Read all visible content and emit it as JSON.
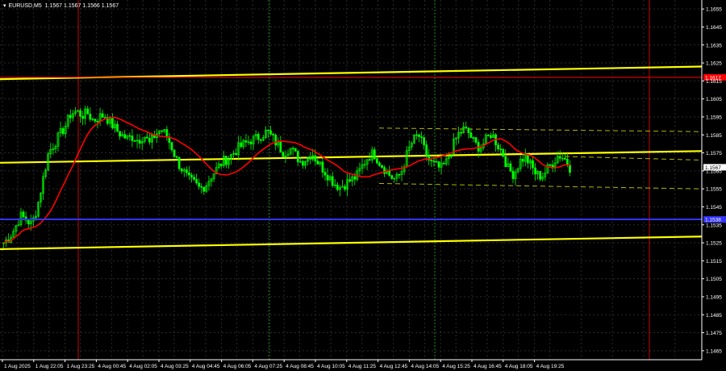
{
  "header": {
    "symbol_label": "EURUSD,M5",
    "ohlc": "1.1567 1.1567 1.1566 1.1567"
  },
  "colors": {
    "background": "#000000",
    "grid": "#2b2b2b",
    "candle": "#00ff00",
    "ma": "#ff0000",
    "channel": "#ffff00",
    "channel_dashed": "#b5b500",
    "level_red": "#ff0000",
    "level_blue": "#3333ff",
    "session_line": "#cc0000",
    "vline_green": "#228b22",
    "axis_text": "#ffffff"
  },
  "chart_data": {
    "type": "candlestick",
    "y_axis": {
      "min": 1.146,
      "max": 1.166,
      "ticks": [
        "1.1655",
        "1.1645",
        "1.1635",
        "1.1625",
        "1.1615",
        "1.1605",
        "1.1595",
        "1.1585",
        "1.1575",
        "1.1565",
        "1.1555",
        "1.1545",
        "1.1535",
        "1.1525",
        "1.1515",
        "1.1505",
        "1.1495",
        "1.1485",
        "1.1475",
        "1.1465"
      ]
    },
    "x_axis": {
      "ticks": [
        "1 Aug 2025",
        "1 Aug 22:05",
        "1 Aug 23:25",
        "4 Aug 00:45",
        "4 Aug 02:05",
        "4 Aug 03:25",
        "4 Aug 04:45",
        "4 Aug 06:05",
        "4 Aug 07:25",
        "4 Aug 08:45",
        "4 Aug 10:05",
        "4 Aug 11:25",
        "4 Aug 12:45",
        "4 Aug 14:05",
        "4 Aug 15:25",
        "4 Aug 16:45",
        "4 Aug 18:05",
        "4 Aug 19:25"
      ]
    },
    "price_path": [
      1.1525,
      1.1528,
      1.1533,
      1.154,
      1.1538,
      1.1535,
      1.1545,
      1.156,
      1.1575,
      1.158,
      1.1585,
      1.159,
      1.1597,
      1.1598,
      1.1596,
      1.1597,
      1.1593,
      1.1595,
      1.1596,
      1.1592,
      1.1588,
      1.1585,
      1.1583,
      1.1584,
      1.1582,
      1.1585,
      1.158,
      1.1585,
      1.1588,
      1.1585,
      1.1578,
      1.157,
      1.1565,
      1.156,
      1.1558,
      1.1555,
      1.1557,
      1.1562,
      1.1566,
      1.157,
      1.1572,
      1.1575,
      1.1578,
      1.158,
      1.1582,
      1.1583,
      1.1585,
      1.1587,
      1.1583,
      1.1579,
      1.1575,
      1.1578,
      1.1574,
      1.157,
      1.1572,
      1.1575,
      1.157,
      1.1566,
      1.1562,
      1.1558,
      1.1556,
      1.1558,
      1.156,
      1.1562,
      1.1568,
      1.1573,
      1.1575,
      1.157,
      1.1566,
      1.1562,
      1.156,
      1.1565,
      1.1575,
      1.1582,
      1.1585,
      1.1577,
      1.157,
      1.1568,
      1.1566,
      1.157,
      1.1578,
      1.1585,
      1.1588,
      1.1586,
      1.158,
      1.1578,
      1.1582,
      1.1586,
      1.158,
      1.1575,
      1.1566,
      1.1563,
      1.157,
      1.1573,
      1.1568,
      1.1563,
      1.1562,
      1.1566,
      1.157,
      1.1574,
      1.1572,
      1.1567
    ],
    "levels": [
      {
        "price": 1.1617,
        "label": "1.1617",
        "color": "#ff0000"
      },
      {
        "price": 1.1538,
        "label": "1.1538",
        "color": "#3333ff"
      }
    ],
    "current_price": {
      "price": 1.1567,
      "label": "1.1567"
    },
    "channels": {
      "upper": [
        1.1616,
        1.1623
      ],
      "middle": [
        1.15695,
        1.1576
      ],
      "lower": [
        1.15215,
        1.15285
      ],
      "dashed_upper": [
        1.15888,
        1.15868
      ],
      "dashed_lower": [
        1.1558,
        1.1555
      ]
    },
    "grid": true
  }
}
